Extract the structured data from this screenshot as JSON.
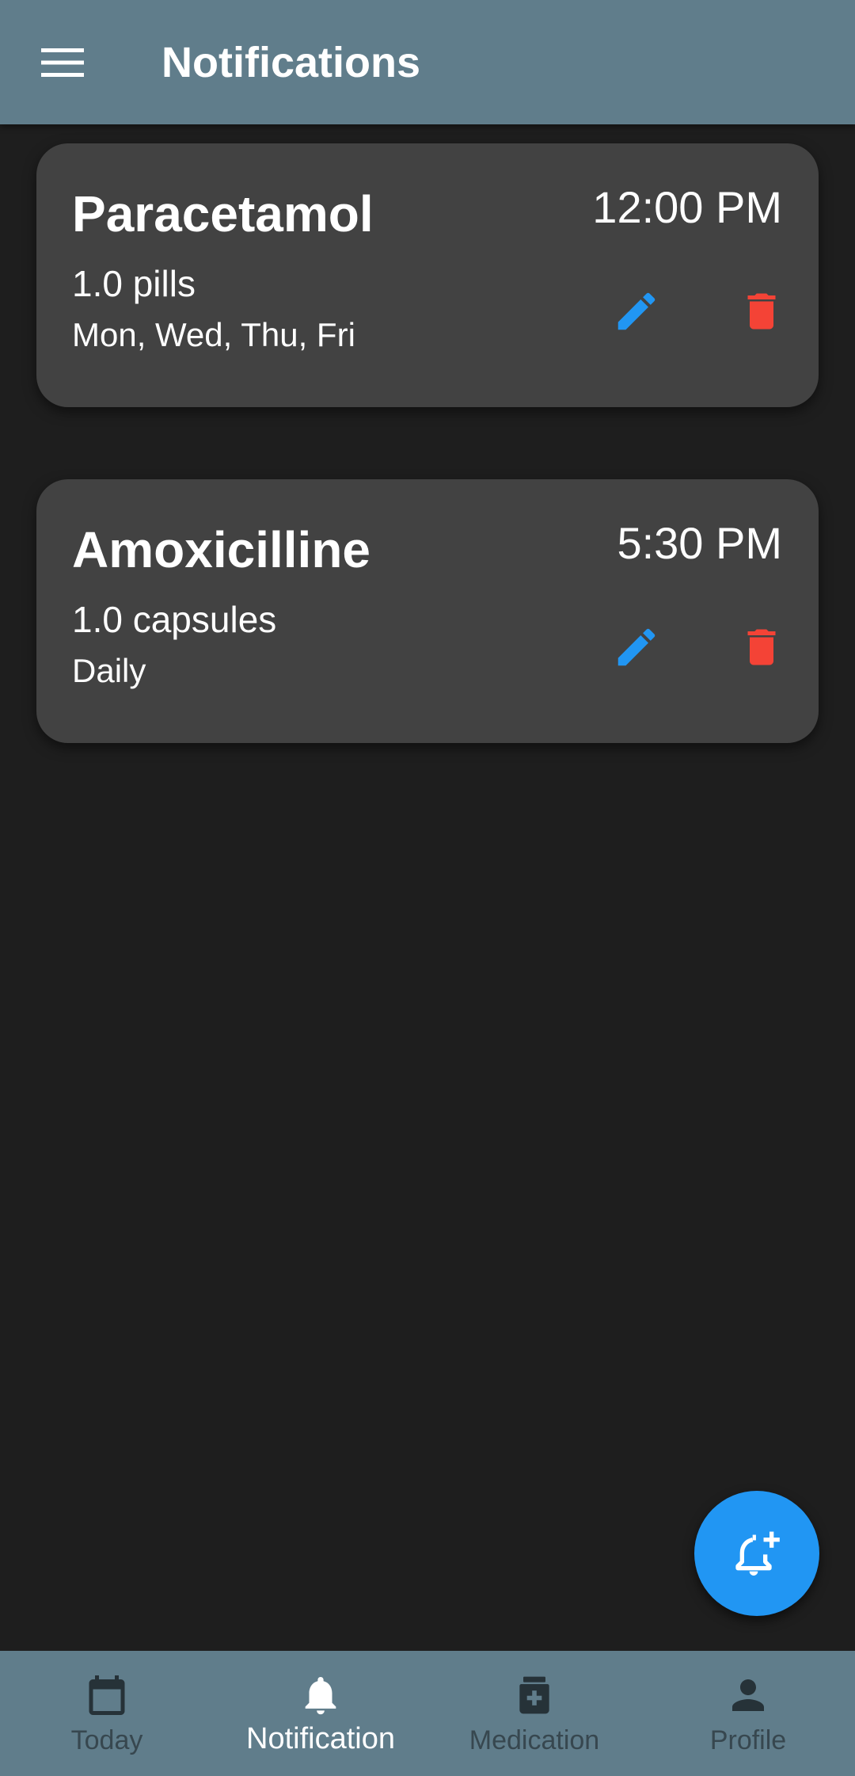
{
  "appbar": {
    "title": "Notifications",
    "menu_icon": "menu-icon"
  },
  "notifications": [
    {
      "name": "Paracetamol",
      "time": "12:00 PM",
      "dose": "1.0 pills",
      "schedule": "Mon, Wed, Thu, Fri",
      "edit_icon": "pencil-icon",
      "delete_icon": "trash-icon"
    },
    {
      "name": "Amoxicilline",
      "time": "5:30 PM",
      "dose": "1.0 capsules",
      "schedule": "Daily",
      "edit_icon": "pencil-icon",
      "delete_icon": "trash-icon"
    }
  ],
  "fab": {
    "icon": "add-alarm-bell-icon"
  },
  "bottom_nav": {
    "items": [
      {
        "label": "Today",
        "icon": "calendar-icon",
        "active": false
      },
      {
        "label": "Notification",
        "icon": "bell-icon",
        "active": true
      },
      {
        "label": "Medication",
        "icon": "medicine-box-icon",
        "active": false
      },
      {
        "label": "Profile",
        "icon": "person-icon",
        "active": false
      }
    ]
  },
  "colors": {
    "appbar": "#607d8b",
    "background": "#1e1e1e",
    "card": "#424242",
    "accent_blue": "#2196f3",
    "delete_red": "#f44336",
    "nav_inactive": "#37474f",
    "nav_active": "#ffffff"
  }
}
